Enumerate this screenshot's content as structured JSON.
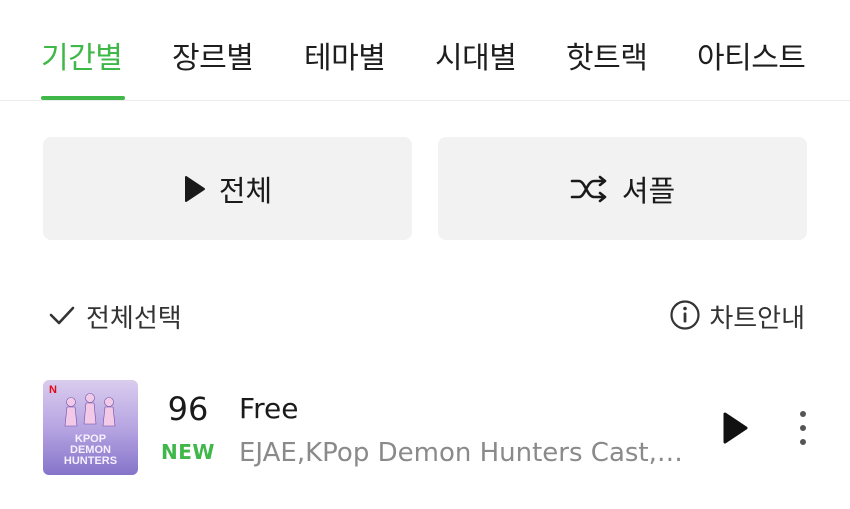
{
  "tabs": [
    {
      "label": "기간별",
      "active": true
    },
    {
      "label": "장르별",
      "active": false
    },
    {
      "label": "테마별",
      "active": false
    },
    {
      "label": "시대별",
      "active": false
    },
    {
      "label": "핫트랙",
      "active": false
    },
    {
      "label": "아티스트",
      "active": false
    }
  ],
  "colors": {
    "accent": "#3fb749",
    "button_bg": "#f2f2f2",
    "secondary_text": "#8a8a8a"
  },
  "actions": {
    "play_all": "전체",
    "shuffle": "셔플"
  },
  "list_controls": {
    "select_all": "전체선택",
    "chart_info": "차트안내"
  },
  "tracks": [
    {
      "rank": "96",
      "badge": "NEW",
      "title": "Free",
      "artist": "EJAE,KPop Demon Hunters Cast,Rumi",
      "album_art_text": "KPOP DEMON HUNTERS"
    }
  ]
}
